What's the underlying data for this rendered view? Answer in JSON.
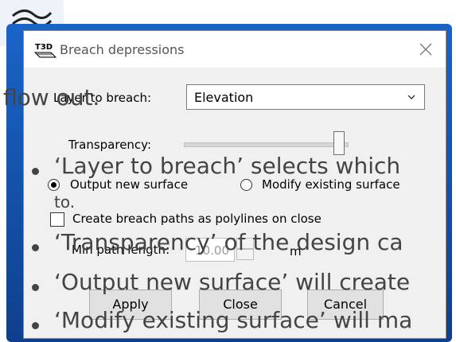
{
  "dialog": {
    "title": "Breach depressions",
    "icon_text": "T3D",
    "layer_label": "Layer to breach:",
    "layer_value": "Elevation",
    "transparency_label": "Transparency:",
    "transparency_level": 0.95,
    "radio_output": "Output new surface",
    "radio_modify": "Modify existing surface",
    "selected_radio": "output",
    "checkbox_label": "Create breach paths as polylines on close",
    "checkbox_checked": false,
    "min_path_label": "Min path length:",
    "min_path_value": "10.00",
    "min_path_unit": "m",
    "buttons": {
      "apply": "Apply",
      "close": "Close",
      "cancel": "Cancel"
    }
  },
  "overlay": {
    "fragment": "flow out.",
    "bullets": [
      "‘Layer to breach’ selects which",
      "to.",
      "‘Transparency’ of the design ca",
      "‘Output new surface’ will create",
      "‘Modify existing surface’ will ma"
    ]
  },
  "colors": {
    "accent": "#1a64c8",
    "dialog_bg": "#f0f0f0",
    "overlay_text": "#444444"
  }
}
